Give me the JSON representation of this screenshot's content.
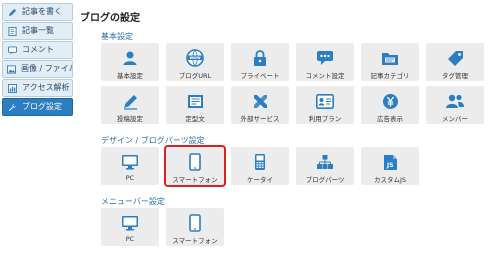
{
  "sidebar": {
    "items": [
      {
        "label": "記事を書く",
        "icon": "pencil-icon",
        "active": false
      },
      {
        "label": "記事一覧",
        "icon": "document-list-icon",
        "active": false
      },
      {
        "label": "コメント",
        "icon": "comment-icon",
        "active": false
      },
      {
        "label": "画像 / ファイル",
        "icon": "image-icon",
        "active": false
      },
      {
        "label": "アクセス解析",
        "icon": "chart-icon",
        "active": false
      },
      {
        "label": "ブログ設定",
        "icon": "wrench-icon",
        "active": true
      }
    ]
  },
  "page": {
    "title": "ブログの設定"
  },
  "sections": {
    "basic": {
      "label": "基本設定",
      "tiles": [
        {
          "label": "基本設定",
          "icon": "person-icon"
        },
        {
          "label": "ブログURL",
          "icon": "www-globe-icon"
        },
        {
          "label": "プライベート",
          "icon": "lock-icon"
        },
        {
          "label": "コメント設定",
          "icon": "speech-bubble-icon"
        },
        {
          "label": "記事カテゴリ",
          "icon": "folder-icon"
        },
        {
          "label": "タグ管理",
          "icon": "tag-icon"
        },
        {
          "label": "投稿設定",
          "icon": "pen-icon"
        },
        {
          "label": "定型文",
          "icon": "template-icon"
        },
        {
          "label": "外部サービス",
          "icon": "tools-icon"
        },
        {
          "label": "利用プラン",
          "icon": "id-card-icon"
        },
        {
          "label": "広告表示",
          "icon": "yen-coin-icon"
        },
        {
          "label": "メンバー",
          "icon": "members-icon"
        }
      ]
    },
    "design": {
      "label": "デザイン / ブログパーツ設定",
      "tiles": [
        {
          "label": "PC",
          "icon": "monitor-icon"
        },
        {
          "label": "スマートフォン",
          "icon": "smartphone-icon"
        },
        {
          "label": "ケータイ",
          "icon": "feature-phone-icon"
        },
        {
          "label": "ブログパーツ",
          "icon": "blocks-icon"
        },
        {
          "label": "カスタムJS",
          "icon": "js-file-icon"
        }
      ]
    },
    "menu": {
      "label": "メニューバー設定",
      "tiles": [
        {
          "label": "PC",
          "icon": "monitor-icon"
        },
        {
          "label": "スマートフォン",
          "icon": "smartphone-icon"
        }
      ]
    }
  },
  "colors": {
    "accent": "#2b7ec1",
    "icon": "#2b7ec1",
    "highlight": "#e02020",
    "tile_bg": "#ececec"
  }
}
